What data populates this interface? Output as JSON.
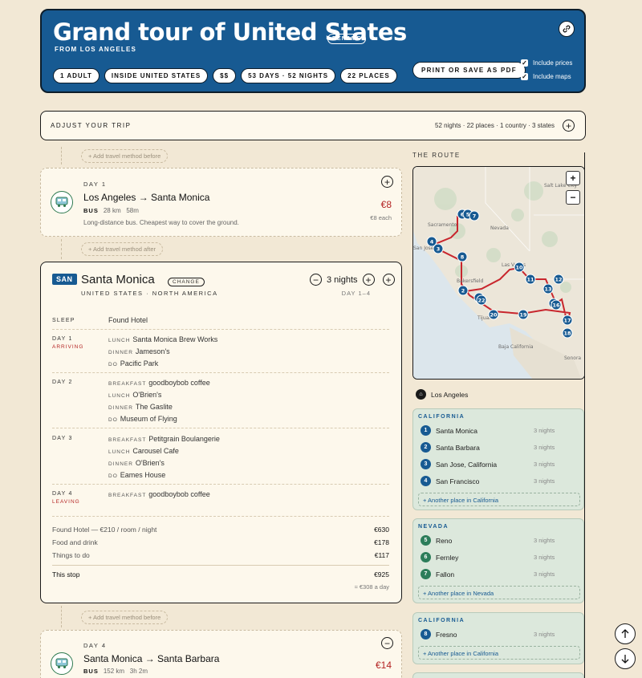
{
  "header": {
    "title": "Grand tour of United States",
    "rename": "RENAME",
    "from": "FROM LOS ANGELES",
    "chips": [
      "1 ADULT",
      "INSIDE UNITED STATES",
      "$$",
      "53 DAYS · 52 NIGHTS",
      "22 PLACES"
    ],
    "print_label": "PRINT OR SAVE AS PDF",
    "include_prices": "Include prices",
    "include_maps": "Include maps"
  },
  "adjust": {
    "label": "ADJUST YOUR TRIP",
    "summary": "52 nights · 22 places · 1 country · 3 states"
  },
  "travel_before": "+ Add travel method before",
  "travel_after": "+ Add travel method after",
  "travel_between": "+ Add travel method before",
  "transport1": {
    "day": "DAY 1",
    "route": "Los Angeles → Santa Monica",
    "mode": "BUS",
    "distance": "28 km",
    "duration": "58m",
    "note": "Long-distance bus. Cheapest way to cover the ground.",
    "price": "€8",
    "price_note": "€8 each"
  },
  "stop": {
    "code": "SAN",
    "name": "Santa Monica",
    "change": "CHANGE",
    "country": "UNITED STATES · NORTH AMERICA",
    "nights": "3 nights",
    "days": "DAY 1–4",
    "sleep_label": "SLEEP",
    "sleep_value": "Found Hotel",
    "day1": {
      "label": "DAY 1",
      "sub": "ARRIVING",
      "lunch": "Santa Monica Brew Works",
      "dinner": "Jameson's",
      "do": "Pacific Park"
    },
    "day2": {
      "label": "DAY 2",
      "breakfast": "goodboybob coffee",
      "lunch": "O'Brien's",
      "dinner": "The Gaslite",
      "do": "Museum of Flying"
    },
    "day3": {
      "label": "DAY 3",
      "breakfast": "Petitgrain Boulangerie",
      "lunch": "Carousel Cafe",
      "dinner": "O'Brien's",
      "do": "Eames House"
    },
    "day4": {
      "label": "DAY 4",
      "sub": "LEAVING",
      "breakfast": "goodboybob coffee"
    },
    "keys": {
      "breakfast": "BREAKFAST",
      "lunch": "LUNCH",
      "dinner": "DINNER",
      "do": "DO"
    },
    "costs": [
      {
        "label": "Found Hotel — €210 / room / night",
        "value": "€630"
      },
      {
        "label": "Food and drink",
        "value": "€178"
      },
      {
        "label": "Things to do",
        "value": "€117"
      }
    ],
    "total_label": "This stop",
    "total_value": "€925",
    "per_day": "≈ €308 a day"
  },
  "transport2": {
    "day": "DAY 4",
    "route": "Santa Monica → Santa Barbara",
    "mode": "BUS",
    "distance": "152 km",
    "duration": "3h 2m",
    "price": "€14"
  },
  "route_panel": {
    "label": "THE ROUTE",
    "start": "Los Angeles",
    "map_labels": [
      "Salt Lake City",
      "Nevada",
      "Sacramento",
      "San Jose",
      "Bakersfield",
      "Las Vegas",
      "Tijuana",
      "Baja California",
      "Sonora"
    ],
    "groups": [
      {
        "state": "CALIFORNIA",
        "color": "#175a92",
        "places": [
          {
            "n": "1",
            "name": "Santa Monica",
            "nights": "3 nights"
          },
          {
            "n": "2",
            "name": "Santa Barbara",
            "nights": "3 nights"
          },
          {
            "n": "3",
            "name": "San Jose, California",
            "nights": "3 nights"
          },
          {
            "n": "4",
            "name": "San Francisco",
            "nights": "3 nights"
          }
        ],
        "another": "+ Another place in California"
      },
      {
        "state": "NEVADA",
        "color": "#2c7d5a",
        "places": [
          {
            "n": "5",
            "name": "Reno",
            "nights": "3 nights"
          },
          {
            "n": "6",
            "name": "Fernley",
            "nights": "3 nights"
          },
          {
            "n": "7",
            "name": "Fallon",
            "nights": "3 nights"
          }
        ],
        "another": "+ Another place in Nevada"
      },
      {
        "state": "CALIFORNIA",
        "color": "#175a92",
        "places": [
          {
            "n": "8",
            "name": "Fresno",
            "nights": "3 nights"
          }
        ],
        "another": "+ Another place in California"
      }
    ]
  }
}
